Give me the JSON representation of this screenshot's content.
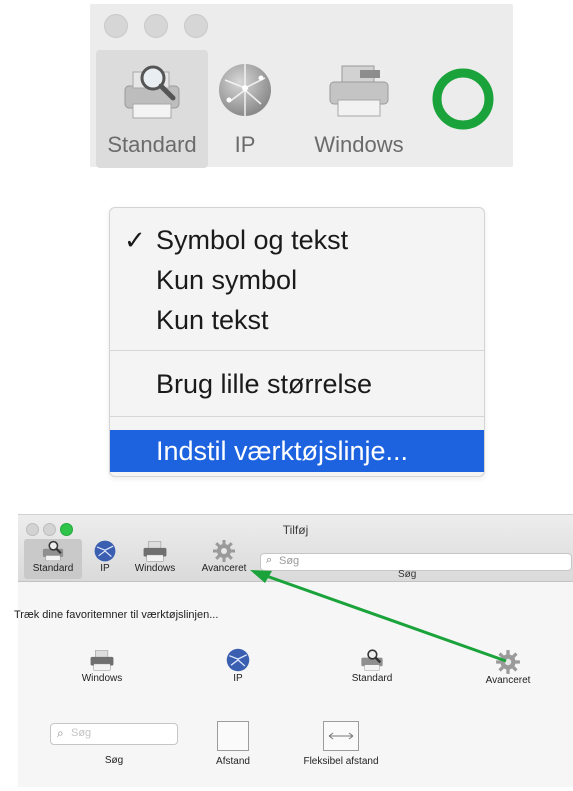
{
  "panel1": {
    "items": [
      {
        "label": "Standard",
        "icon": "printer-magnifier-icon",
        "selected": true
      },
      {
        "label": "IP",
        "icon": "globe-icon",
        "selected": false
      },
      {
        "label": "Windows",
        "icon": "printer-icon",
        "selected": false
      }
    ],
    "annotation_color": "#1aa33a"
  },
  "menu": {
    "items": [
      {
        "label": "Symbol og tekst",
        "checked": true
      },
      {
        "label": "Kun symbol",
        "checked": false
      },
      {
        "label": "Kun tekst",
        "checked": false
      },
      {
        "label": "Brug lille størrelse",
        "checked": false
      },
      {
        "label": "Indstil værktøjslinje...",
        "highlighted": true
      }
    ],
    "highlight_color": "#1d63e0"
  },
  "window": {
    "title": "Tilføj",
    "toolbar": {
      "items": [
        {
          "label": "Standard",
          "icon": "printer-magnifier-icon",
          "selected": true
        },
        {
          "label": "IP",
          "icon": "globe-icon"
        },
        {
          "label": "Windows",
          "icon": "printer-icon"
        },
        {
          "label": "Avanceret",
          "icon": "gear-icon"
        }
      ],
      "search_placeholder": "Søg",
      "search_label": "Søg"
    },
    "instruction": "Træk dine favoritemner til værktøjslinjen...",
    "palette": [
      {
        "label": "Windows",
        "icon": "printer-icon"
      },
      {
        "label": "IP",
        "icon": "globe-icon"
      },
      {
        "label": "Standard",
        "icon": "printer-magnifier-icon"
      },
      {
        "label": "Avanceret",
        "icon": "gear-icon"
      }
    ],
    "palette_row2": {
      "search_label": "Søg",
      "search_placeholder": "Søg",
      "space_label": "Afstand",
      "flex_space_label": "Fleksibel afstand"
    },
    "arrow_color": "#1aa33a"
  }
}
